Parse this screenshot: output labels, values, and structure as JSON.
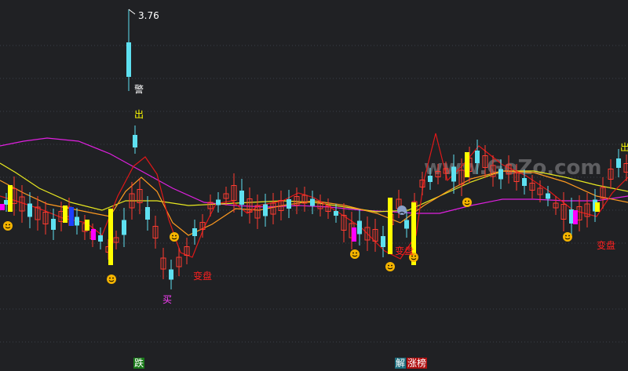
{
  "chart_data": {
    "type": "candlestick",
    "max_label": "3.76",
    "watermark": "www.GoZo.com",
    "colors": {
      "background": "#202124",
      "grid": "#3a3f48",
      "up": "#ff3b30",
      "down": "#5ee0f0",
      "signal_yellow": "#ffff00",
      "signal_magenta": "#ff00ff",
      "signal_blue": "#1e40ff",
      "ma_magenta": "#e020e0",
      "ma_yellow": "#e8e820",
      "ma_orange": "#ff9a20",
      "ma_red": "#e01818",
      "smiley": "#f5b400"
    },
    "annotations": [
      {
        "key": "warn",
        "text": "警",
        "color": "#ffffff"
      },
      {
        "key": "out1",
        "text": "出",
        "color": "#ffff00"
      },
      {
        "key": "buy",
        "text": "买",
        "color": "#ff40ff"
      },
      {
        "key": "change1",
        "text": "变盘",
        "color": "#ff2020"
      },
      {
        "key": "change2",
        "text": "变盘",
        "color": "#ff2020"
      },
      {
        "key": "change3",
        "text": "变盘",
        "color": "#ff2020"
      },
      {
        "key": "out2",
        "text": "出",
        "color": "#ffff00"
      }
    ],
    "bottom_tags": [
      {
        "key": "fall",
        "text": "跌",
        "color": "#ffffff",
        "bg": "#1a7a1a"
      },
      {
        "key": "solve",
        "text": "解",
        "color": "#ffffff",
        "bg": "#1f6f7f"
      },
      {
        "key": "limitup",
        "text": "涨榜",
        "color": "#ffffff",
        "bg": "#b01010"
      }
    ]
  }
}
